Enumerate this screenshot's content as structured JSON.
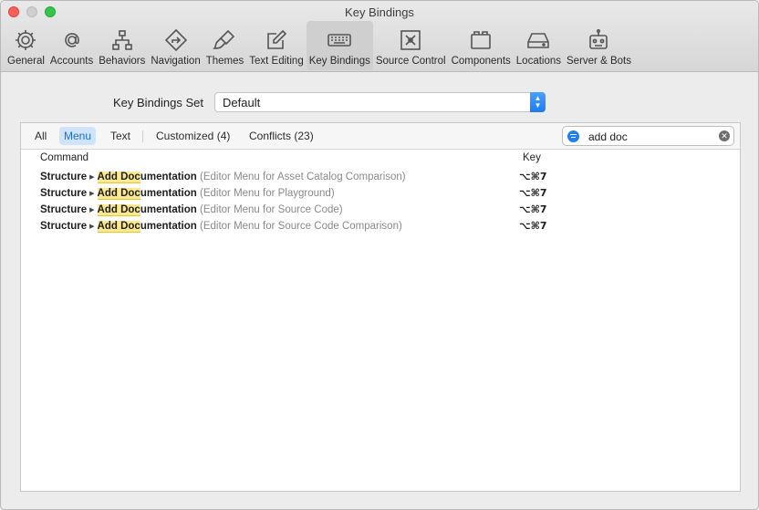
{
  "window": {
    "title": "Key Bindings"
  },
  "toolbar": {
    "items": [
      {
        "label": "General",
        "icon": "gear-icon"
      },
      {
        "label": "Accounts",
        "icon": "at-sign-icon"
      },
      {
        "label": "Behaviors",
        "icon": "hierarchy-icon"
      },
      {
        "label": "Navigation",
        "icon": "navigation-arrow-icon"
      },
      {
        "label": "Themes",
        "icon": "paintbrush-icon"
      },
      {
        "label": "Text Editing",
        "icon": "pencil-square-icon"
      },
      {
        "label": "Key Bindings",
        "icon": "keyboard-icon",
        "active": true
      },
      {
        "label": "Source Control",
        "icon": "source-control-icon"
      },
      {
        "label": "Components",
        "icon": "components-icon"
      },
      {
        "label": "Locations",
        "icon": "drive-icon"
      },
      {
        "label": "Server & Bots",
        "icon": "robot-icon"
      }
    ]
  },
  "key_bindings_set": {
    "label": "Key Bindings Set",
    "value": "Default"
  },
  "filters": {
    "tabs": [
      {
        "label": "All"
      },
      {
        "label": "Menu",
        "active": true
      },
      {
        "label": "Text"
      },
      {
        "label": "Customized (4)"
      },
      {
        "label": "Conflicts (23)"
      }
    ],
    "search": {
      "value": "add doc",
      "placeholder": ""
    }
  },
  "table": {
    "headers": {
      "command": "Command",
      "key": "Key"
    },
    "rows": [
      {
        "menu": "Structure",
        "cmd_hl1": "Add",
        "cmd_gap": " ",
        "cmd_hl2": "Doc",
        "cmd_rest": "umentation",
        "context": "(Editor Menu for Asset Catalog Comparison)",
        "key": "⌥⌘7"
      },
      {
        "menu": "Structure",
        "cmd_hl1": "Add",
        "cmd_gap": " ",
        "cmd_hl2": "Doc",
        "cmd_rest": "umentation",
        "context": "(Editor Menu for Playground)",
        "key": "⌥⌘7"
      },
      {
        "menu": "Structure",
        "cmd_hl1": "Add",
        "cmd_gap": " ",
        "cmd_hl2": "Doc",
        "cmd_rest": "umentation",
        "context": "(Editor Menu for Source Code)",
        "key": "⌥⌘7"
      },
      {
        "menu": "Structure",
        "cmd_hl1": "Add",
        "cmd_gap": " ",
        "cmd_hl2": "Doc",
        "cmd_rest": "umentation",
        "context": "(Editor Menu for Source Code Comparison)",
        "key": "⌥⌘7"
      }
    ]
  },
  "colors": {
    "highlight": "#fbe98c",
    "accent": "#1f7ef0",
    "active_tab_bg": "#cfe4fb"
  }
}
